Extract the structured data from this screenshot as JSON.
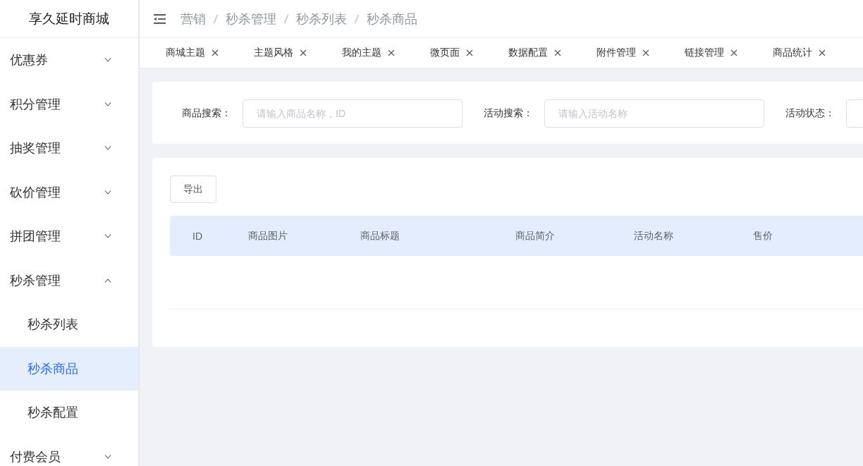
{
  "brand": {
    "title": "享久延时商城"
  },
  "sidebar": {
    "items": [
      {
        "label": "优惠券",
        "expanded": false
      },
      {
        "label": "积分管理",
        "expanded": false
      },
      {
        "label": "抽奖管理",
        "expanded": false
      },
      {
        "label": "砍价管理",
        "expanded": false
      },
      {
        "label": "拼团管理",
        "expanded": false
      },
      {
        "label": "秒杀管理",
        "expanded": true,
        "children": [
          {
            "label": "秒杀列表",
            "selected": false
          },
          {
            "label": "秒杀商品",
            "selected": true
          },
          {
            "label": "秒杀配置",
            "selected": false
          }
        ]
      },
      {
        "label": "付费会员",
        "expanded": false
      }
    ]
  },
  "breadcrumb": [
    "营销",
    "秒杀管理",
    "秒杀列表",
    "秒杀商品"
  ],
  "tabs": [
    {
      "label": "商城主题",
      "selected": false
    },
    {
      "label": "主题风格",
      "selected": false
    },
    {
      "label": "我的主题",
      "selected": false
    },
    {
      "label": "微页面",
      "selected": false
    },
    {
      "label": "数据配置",
      "selected": false
    },
    {
      "label": "附件管理",
      "selected": false
    },
    {
      "label": "链接管理",
      "selected": false
    },
    {
      "label": "商品统计",
      "selected": false
    }
  ],
  "search_form": {
    "fields": [
      {
        "label": "商品搜索：",
        "placeholder": "请输入商品名称，ID"
      },
      {
        "label": "活动搜索：",
        "placeholder": "请输入活动名称"
      },
      {
        "label": "活动状态："
      }
    ]
  },
  "toolbar": {
    "buttons": [
      "导出"
    ]
  },
  "table": {
    "columns": [
      "ID",
      "商品图片",
      "商品标题",
      "商品简介",
      "活动名称",
      "售价"
    ]
  }
}
